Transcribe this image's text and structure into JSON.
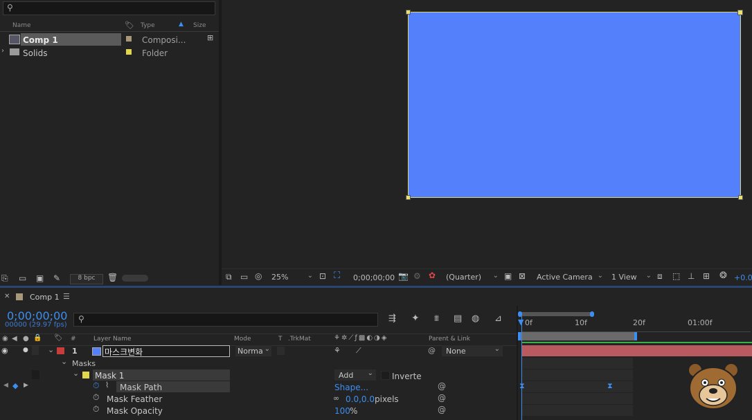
{
  "project": {
    "search_placeholder": "",
    "columns": {
      "name": "Name",
      "type": "Type",
      "size": "Size"
    },
    "items": [
      {
        "name": "Comp 1",
        "type": "Composi...",
        "label_color": "#a8987a",
        "selected": true,
        "kind": "composition"
      },
      {
        "name": "Solids",
        "type": "Folder",
        "label_color": "#e2d64a",
        "selected": false,
        "kind": "folder"
      }
    ],
    "bpc": "8 bpc"
  },
  "viewer": {
    "comp_color": "#5480fc",
    "zoom": "25%",
    "timecode": "0;00;00;00",
    "resolution": "(Quarter)",
    "camera": "Active Camera",
    "views": "1 View",
    "exposure": "+0.0"
  },
  "timeline": {
    "tab_label": "Comp 1",
    "current_time": "0;00;00;00",
    "frame_info": "00000 (29.97 fps)",
    "search_placeholder": "",
    "columns": {
      "hash": "#",
      "layer_name": "Layer Name",
      "mode": "Mode",
      "t": "T",
      "trkmat": ".TrkMat",
      "parent": "Parent & Link"
    },
    "ruler": [
      "0f",
      "10f",
      "20f",
      "01:00f"
    ],
    "layer": {
      "index": "1",
      "name": "마스크변화",
      "mode": "Norma",
      "parent": "None",
      "label_color": "#c83c3c",
      "bar_color": "#c8505a"
    },
    "masks_group": "Masks",
    "mask": {
      "name": "Mask 1",
      "mode": "Add",
      "inverted_label": "Inverte",
      "label_color": "#e2d64a"
    },
    "properties": [
      {
        "name": "Mask Path",
        "value": "Shape...",
        "unit": ""
      },
      {
        "name": "Mask Feather",
        "value": "0.0,0.0",
        "unit": "pixels"
      },
      {
        "name": "Mask Opacity",
        "value": "100",
        "unit": "%"
      }
    ]
  }
}
